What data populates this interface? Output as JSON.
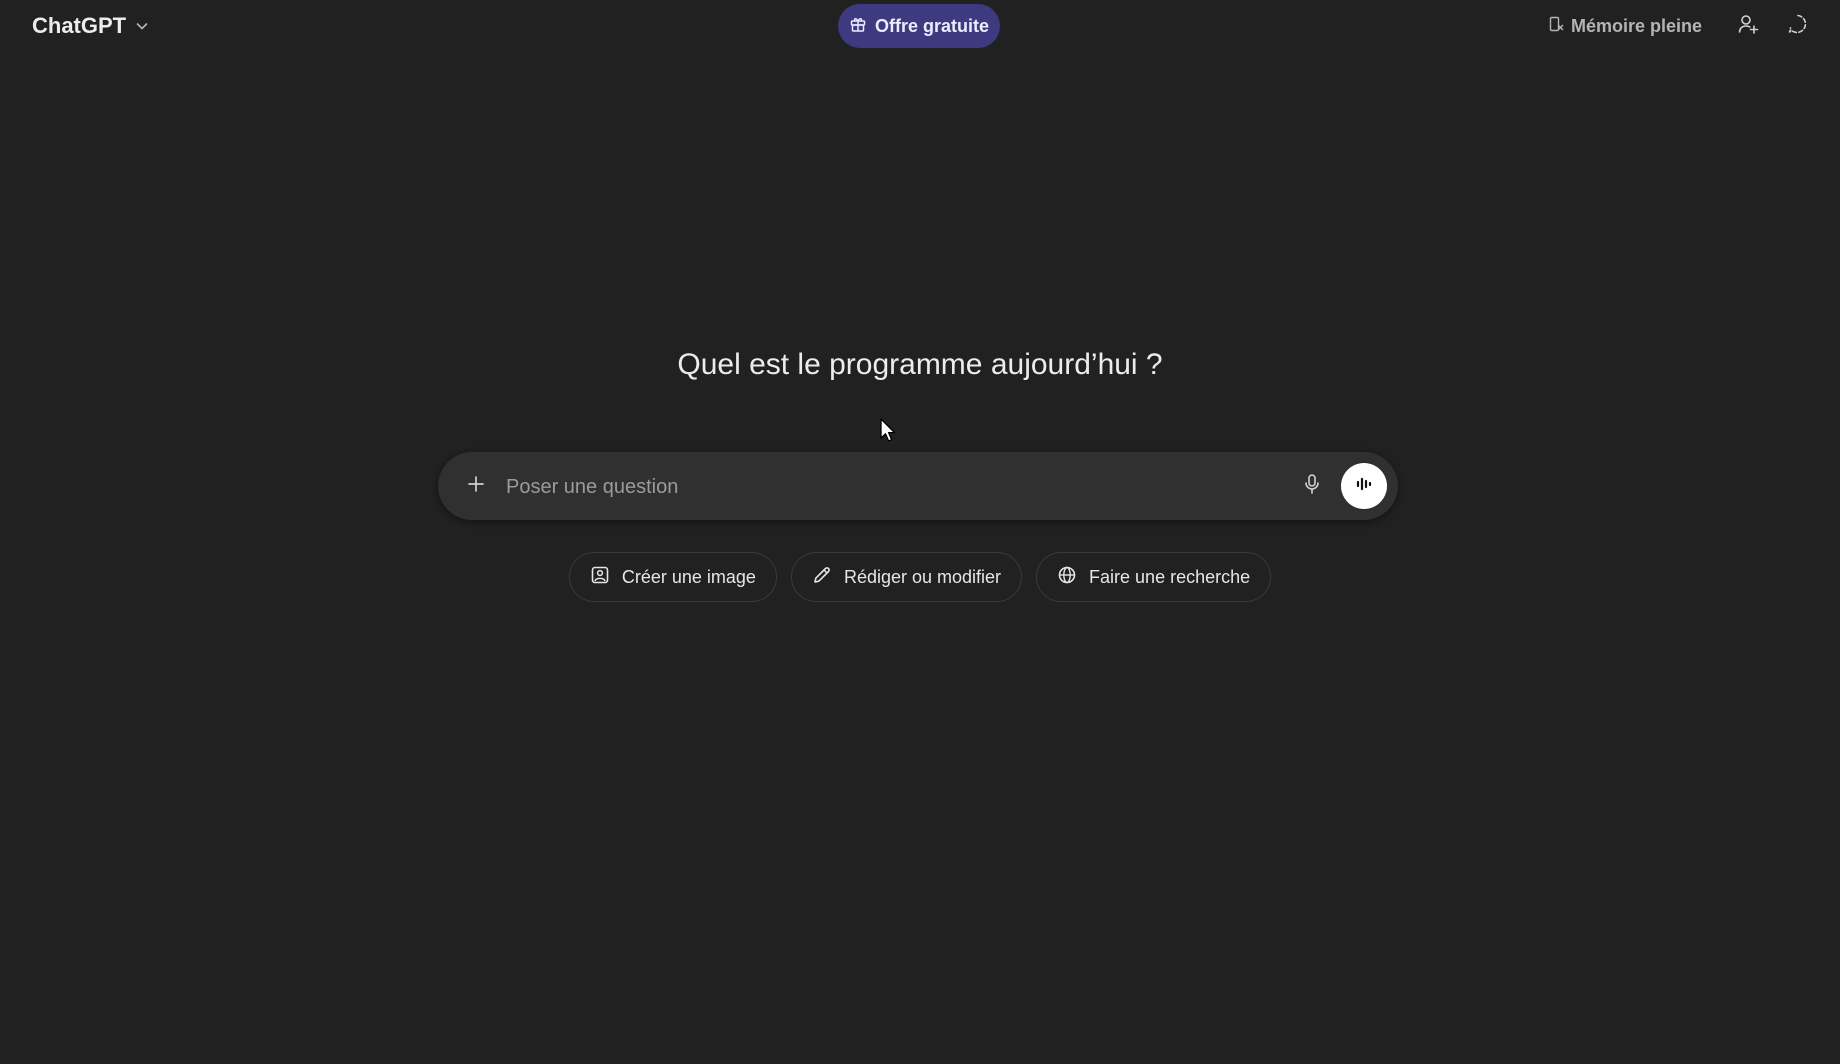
{
  "header": {
    "model_title": "ChatGPT",
    "promo_label": "Offre gratuite",
    "memory_label": "Mémoire pleine"
  },
  "main": {
    "heading": "Quel est le programme aujourd’hui ?"
  },
  "composer": {
    "placeholder": "Poser une question",
    "value": ""
  },
  "suggestions": [
    {
      "label": "Créer une image",
      "icon": "image-icon"
    },
    {
      "label": "Rédiger ou modifier",
      "icon": "pencil-icon"
    },
    {
      "label": "Faire une recherche",
      "icon": "globe-icon"
    }
  ],
  "colors": {
    "background": "#212121",
    "composer": "#303030",
    "promo": "#3d3a80",
    "text": "#ececec"
  }
}
